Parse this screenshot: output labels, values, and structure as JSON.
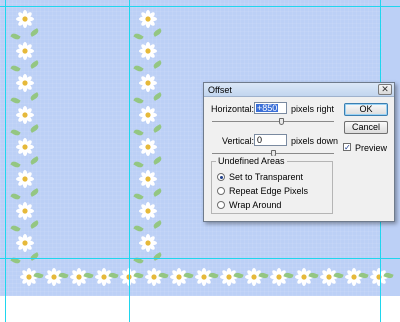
{
  "dialog": {
    "title": "Offset",
    "close_glyph": "✕",
    "horizontal": {
      "label": "Horizontal:",
      "value": "+850",
      "unit": "pixels right"
    },
    "vertical": {
      "label": "Vertical:",
      "value": "0",
      "unit": "pixels down"
    },
    "buttons": {
      "ok": "OK",
      "cancel": "Cancel"
    },
    "preview": {
      "label": "Preview",
      "checked": true,
      "check_glyph": "✓"
    },
    "undefined_areas": {
      "title": "Undefined Areas",
      "options": [
        {
          "label": "Set to Transparent",
          "selected": true
        },
        {
          "label": "Repeat Edge Pixels",
          "selected": false
        },
        {
          "label": "Wrap Around",
          "selected": false
        }
      ]
    }
  },
  "colors": {
    "background": "#bcd0f6",
    "guide": "#1fd6ee",
    "petal": "#ffffff",
    "flower_center": "#e6b93a",
    "leaf": "#94c682"
  },
  "icons": {
    "flower": "daisy-flower-icon",
    "leaf": "leaf-icon",
    "close": "close-icon"
  }
}
